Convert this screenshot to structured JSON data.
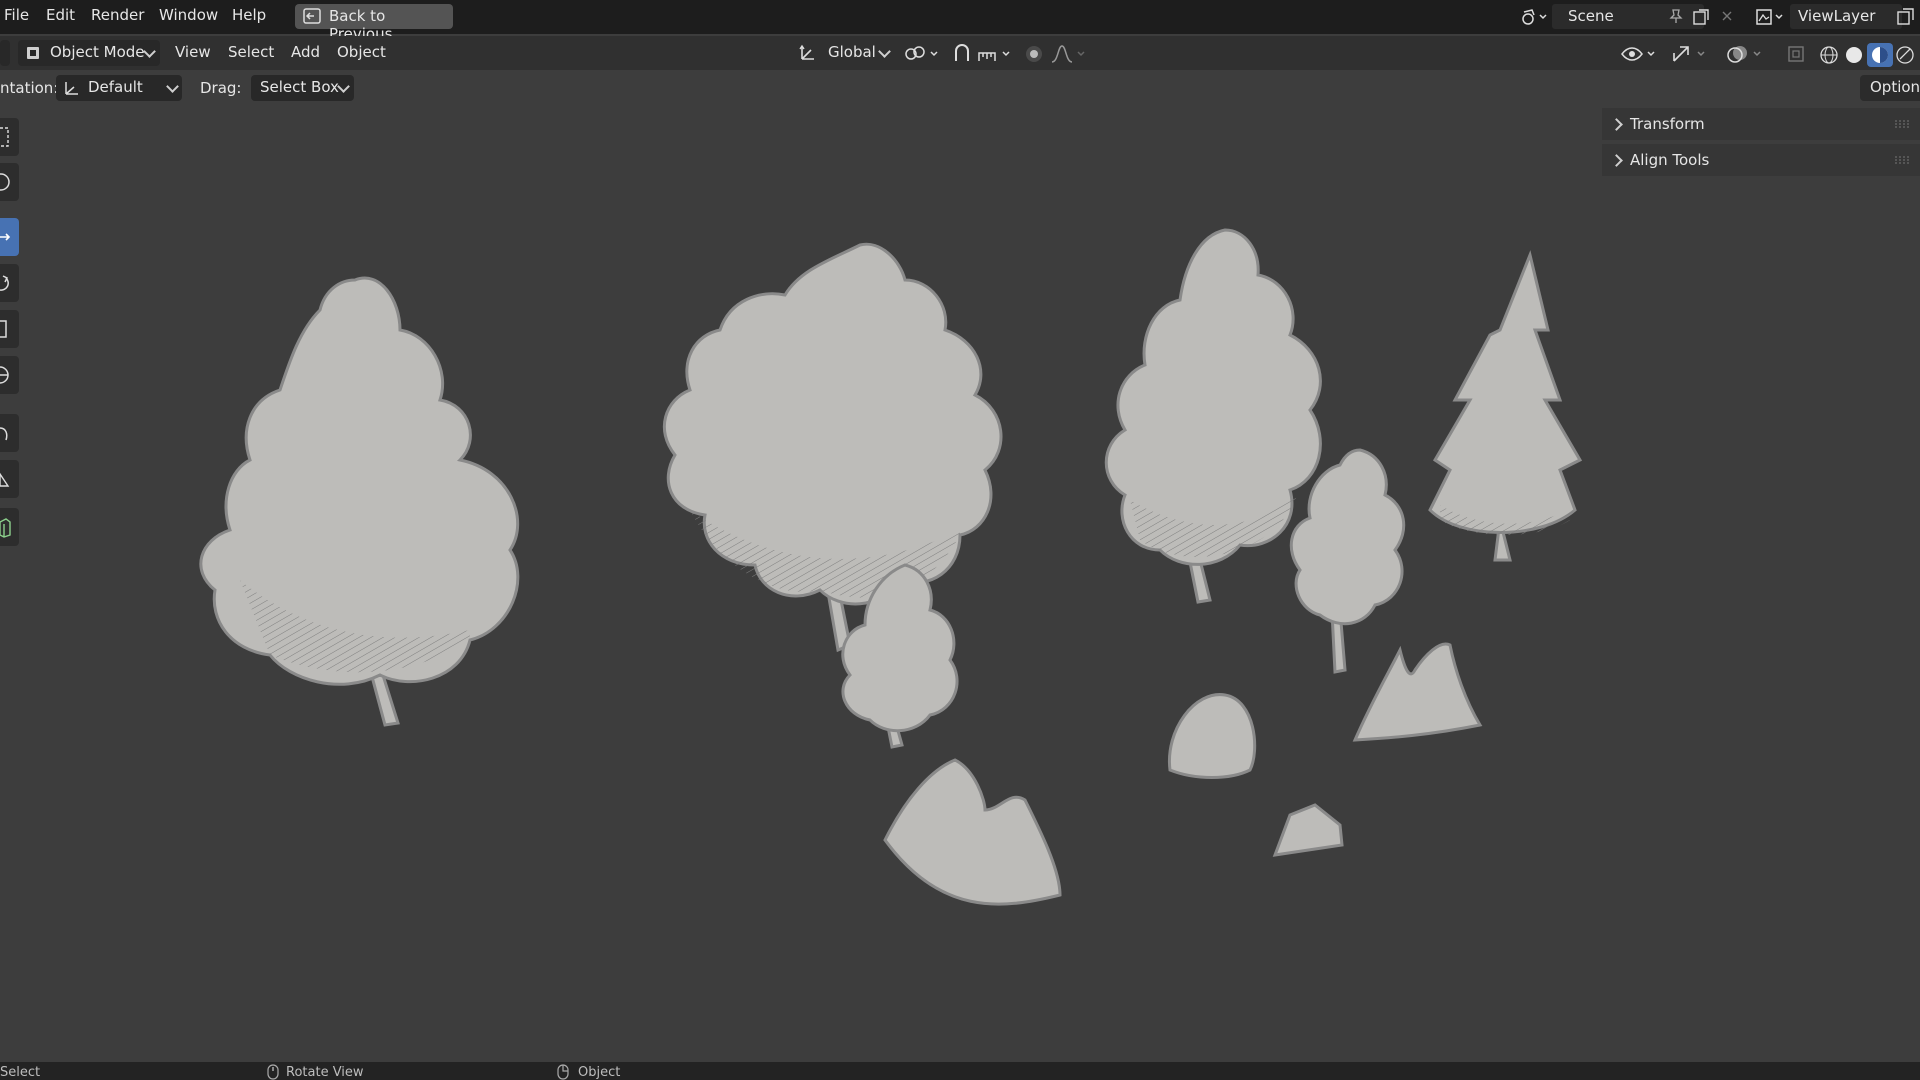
{
  "menu": [
    "File",
    "Edit",
    "Render",
    "Window",
    "Help"
  ],
  "back_to_previous": "Back to Previous",
  "scene": "Scene",
  "view_layer": "ViewLayer",
  "header": {
    "mode": "Object Mode",
    "menus": [
      "View",
      "Select",
      "Add",
      "Object"
    ],
    "transform_orientation": "Global"
  },
  "tool_settings": {
    "orientation_label": "ntation:",
    "orientation_value": "Default",
    "drag_label": "Drag:",
    "drag_value": "Select Box",
    "options": "Options"
  },
  "sidebar_panels": [
    "Transform",
    "Align Tools"
  ],
  "status_bar": [
    "Select",
    "Rotate View",
    "Object"
  ],
  "colors": {
    "active_tool": "#4772b3",
    "viewport_bg": "#3d3d3d",
    "model_fill": "#bdbcb9"
  },
  "icons": [
    "object-mode-icon",
    "orientation-icon",
    "pivot-icon",
    "snap-icon",
    "proportional-edit-icon",
    "visibility-icon",
    "gizmo-icon",
    "overlay-icon",
    "xray-icon",
    "wireframe-shading-icon",
    "solid-shading-icon",
    "material-shading-icon",
    "rendered-shading-icon"
  ]
}
